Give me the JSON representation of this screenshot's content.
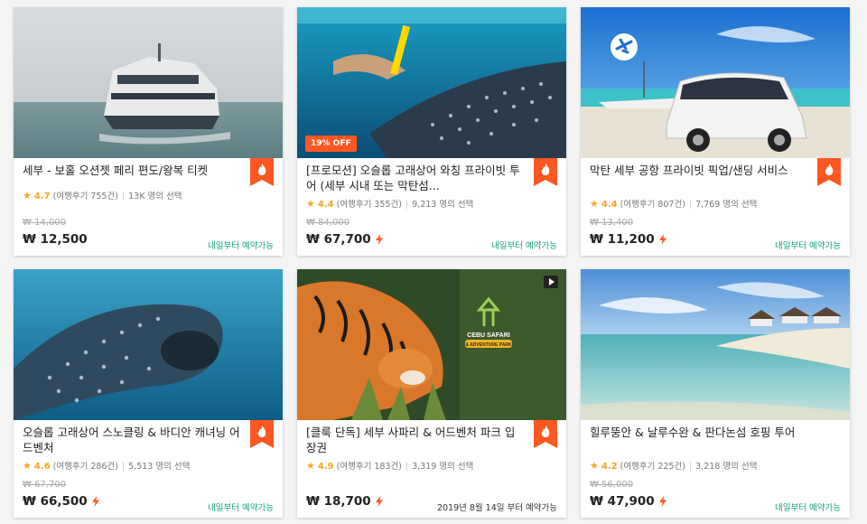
{
  "cards": [
    {
      "title": "세부 - 보홀 오션젯 페리 편도/왕복 티켓",
      "rating": "4.7",
      "reviews": "(여행후기 755건)",
      "booked": "13K 명의 선택",
      "old_price": "₩ 14,000",
      "price": "₩ 12,500",
      "availability": "내일부터 예약가능",
      "has_bolt": false
    },
    {
      "title": "[프로모션] 오슬롭 고래상어 와칭 프라이빗 투어 (세부 시내 또는 막탄섬...",
      "rating": "4.4",
      "reviews": "(여행후기 355건)",
      "booked": "9,213 명의 선택",
      "old_price": "₩ 84,000",
      "price": "₩ 67,700",
      "availability": "내일부터 예약가능",
      "discount": "19% OFF",
      "has_bolt": true
    },
    {
      "title": "막탄 세부 공항 프라이빗 픽업/샌딩 서비스",
      "rating": "4.4",
      "reviews": "(여행후기 807건)",
      "booked": "7,769 명의 선택",
      "old_price": "₩ 13,400",
      "price": "₩ 11,200",
      "availability": "내일부터 예약가능",
      "has_bolt": true
    },
    {
      "title": "오슬롭 고래상어 스노클링 & 바디안 캐녀닝 어드벤처",
      "rating": "4.6",
      "reviews": "(여행후기 286건)",
      "booked": "5,513 명의 선택",
      "old_price": "₩ 67,700",
      "price": "₩ 66,500",
      "availability": "내일부터 예약가능",
      "has_bolt": true
    },
    {
      "title": "[클룩 단독] 세부 사파리 & 어드벤처 파크 입장권",
      "rating": "4.9",
      "reviews": "(여행후기 183건)",
      "booked": "3,319 명의 선택",
      "price": "₩ 18,700",
      "availability": "2019년 8월 14일 부터 예약가능",
      "has_bolt": true,
      "logo_line1": "CEBU SAFARI",
      "logo_line2": "& ADVENTURE PARK"
    },
    {
      "title": "힐루뚱안 & 날루수완 & 판다논섬 호핑 투어",
      "rating": "4.2",
      "reviews": "(여행후기 225건)",
      "booked": "3,218 명의 선택",
      "old_price": "₩ 56,000",
      "price": "₩ 47,900",
      "availability": "내일부터 예약가능",
      "has_bolt": true
    }
  ],
  "colors": {
    "accent": "#ff5722",
    "rating": "#f5a623",
    "available": "#10a37f"
  },
  "icons": [
    "fire-icon",
    "star-icon",
    "bolt-icon",
    "video-icon",
    "airplane-icon"
  ]
}
